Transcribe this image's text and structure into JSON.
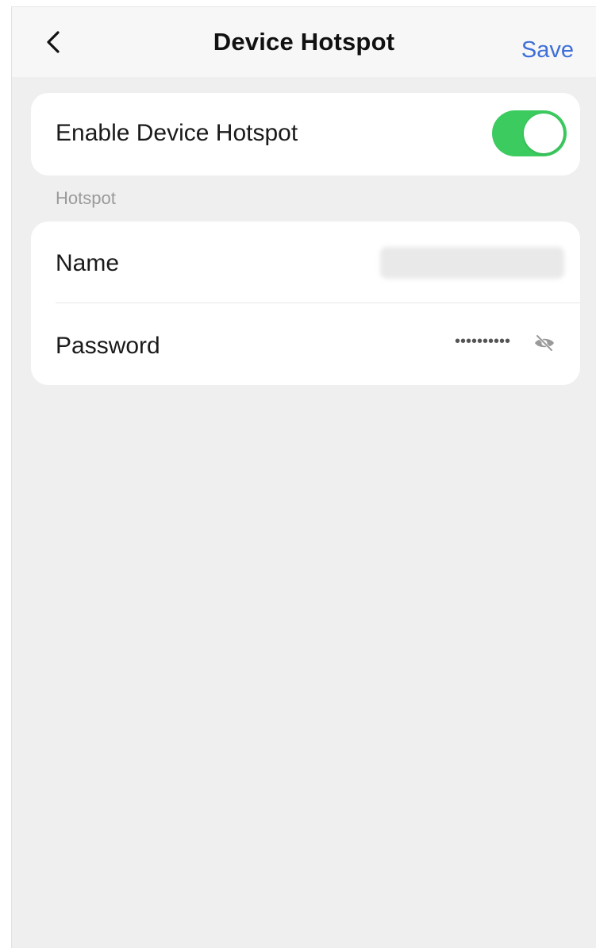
{
  "navbar": {
    "back_icon": "chevron-left-icon",
    "title": "Device Hotspot",
    "save_label": "Save"
  },
  "enable_card": {
    "label": "Enable Device Hotspot",
    "toggle_on": true,
    "toggle_color": "#3ccb5f"
  },
  "hotspot_section": {
    "header": "Hotspot",
    "name_label": "Name",
    "name_value": "",
    "password_label": "Password",
    "password_masked": "••••••••••",
    "visibility_icon": "eye-off-icon"
  },
  "colors": {
    "accent": "#3e6fd8",
    "background": "#efefef",
    "card": "#ffffff"
  }
}
